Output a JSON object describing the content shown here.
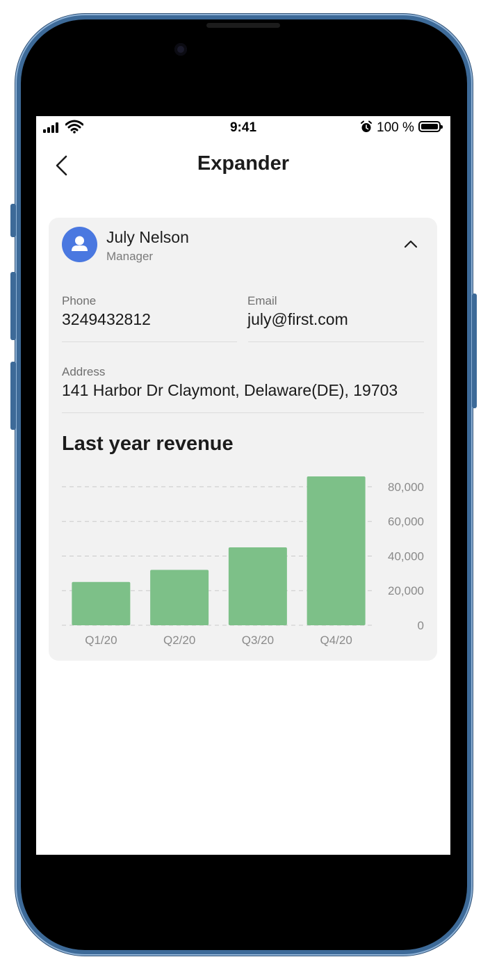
{
  "status_bar": {
    "time": "9:41",
    "battery": "100 %"
  },
  "nav": {
    "title": "Expander"
  },
  "contact": {
    "name": "July Nelson",
    "role": "Manager",
    "phone_label": "Phone",
    "phone": "3249432812",
    "email_label": "Email",
    "email": "july@first.com",
    "address_label": "Address",
    "address": "141 Harbor Dr Claymont, Delaware(DE), 19703"
  },
  "chart_title": "Last year revenue",
  "chart_data": {
    "type": "bar",
    "categories": [
      "Q1/20",
      "Q2/20",
      "Q3/20",
      "Q4/20"
    ],
    "values": [
      25000,
      32000,
      45000,
      86000
    ],
    "y_ticks": [
      0,
      20000,
      40000,
      60000,
      80000
    ],
    "y_tick_labels": [
      "0",
      "20,000",
      "40,000",
      "60,000",
      "80,000"
    ],
    "ylim": [
      0,
      86000
    ],
    "grid": true,
    "y_axis_side": "right",
    "bar_color": "#7dc088"
  },
  "colors": {
    "accent": "#4a78e0",
    "card": "#f2f2f2",
    "frame": "#3d6a98"
  }
}
